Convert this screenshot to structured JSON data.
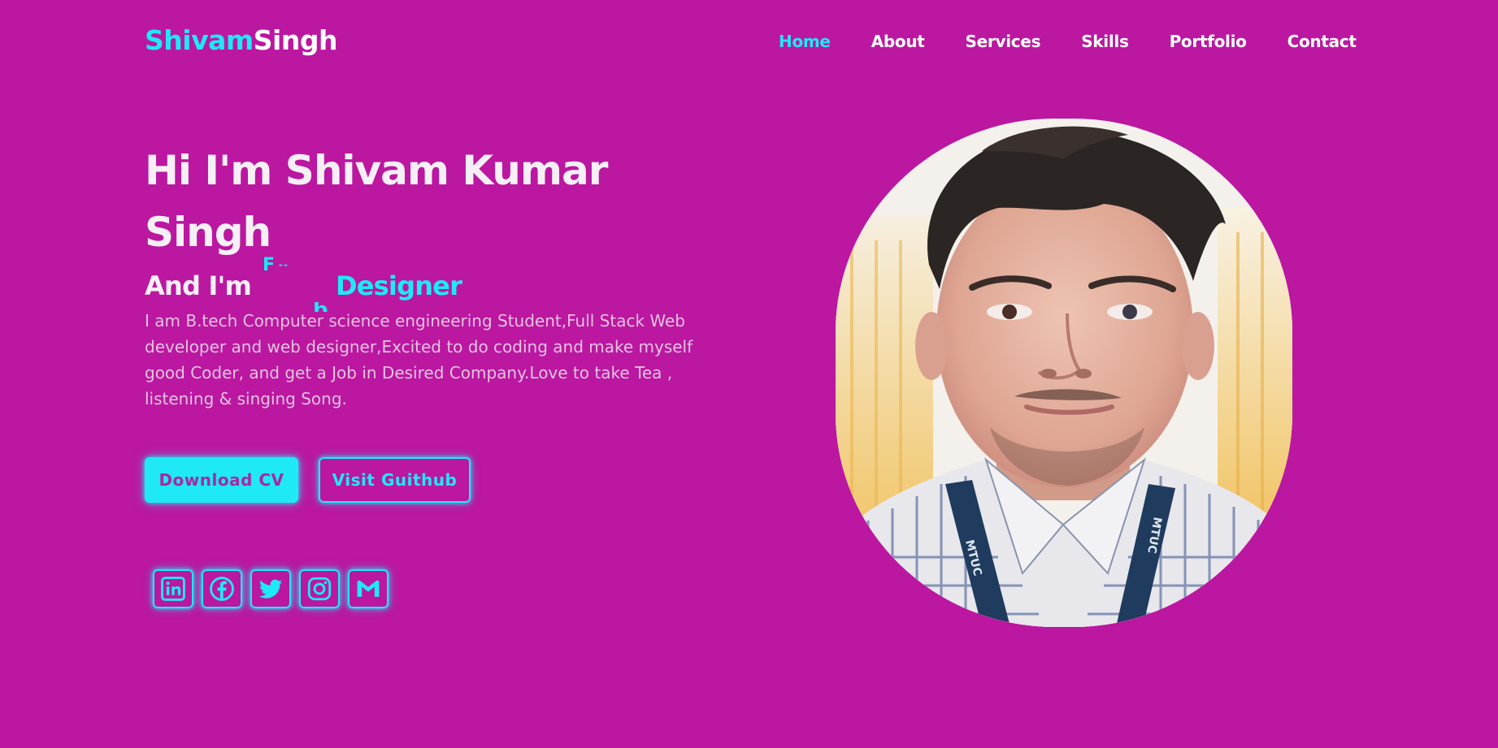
{
  "header": {
    "logo_first": "Shivam",
    "logo_last": "Singh",
    "nav": [
      {
        "label": "Home",
        "active": true
      },
      {
        "label": "About",
        "active": false
      },
      {
        "label": "Services",
        "active": false
      },
      {
        "label": "Skills",
        "active": false
      },
      {
        "label": "Portfolio",
        "active": false
      },
      {
        "label": "Contact",
        "active": false
      }
    ]
  },
  "hero": {
    "title": "Hi I'm Shivam Kumar Singh",
    "subtitle_prefix": "And I'm",
    "typing_fragment_top": "F",
    "typing_fragment_bottom": "b",
    "role": "Designer",
    "description": "I am B.tech Computer science engineering Student,Full Stack Web developer and web designer,Excited to do coding and make myself good Coder, and get a Job in Desired Company.Love to take Tea , listening & singing Song.",
    "buttons": {
      "primary": "Download CV",
      "secondary": "Visit Guithub"
    }
  },
  "socials": [
    {
      "icon": "linkedin-icon"
    },
    {
      "icon": "facebook-icon"
    },
    {
      "icon": "twitter-icon"
    },
    {
      "icon": "instagram-icon"
    },
    {
      "icon": "gmail-icon"
    }
  ],
  "portrait": {
    "lanyard_text": "MTUC"
  },
  "colors": {
    "background": "#bb17a1",
    "accent": "#1ee9f4",
    "text": "#ffffff"
  }
}
